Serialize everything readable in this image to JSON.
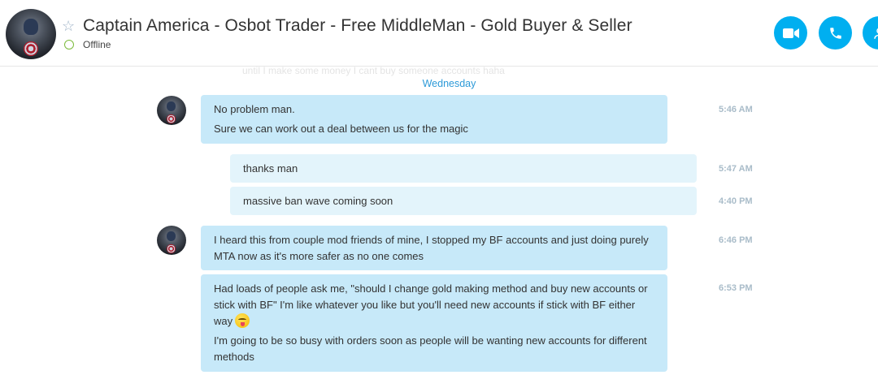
{
  "header": {
    "title": "Captain America - Osbot Trader - Free MiddleMan - Gold Buyer & Seller",
    "status": "Offline",
    "buttons": [
      "video-call",
      "voice-call",
      "add-people"
    ],
    "accent_color": "#00aff0",
    "status_color": "#7cbb3c"
  },
  "conversation": {
    "faded_previous_text": "until I make some money I cant buy someone accounts haha",
    "day_separator": "Wednesday",
    "messages": [
      {
        "direction": "incoming",
        "lines": [
          "No problem man.",
          "Sure we can work out a deal between us for the magic"
        ],
        "time": "5:46 AM"
      },
      {
        "direction": "outgoing",
        "lines": [
          "thanks man"
        ],
        "time": "5:47 AM"
      },
      {
        "direction": "outgoing",
        "lines": [
          "massive ban wave coming soon"
        ],
        "time": "4:40 PM"
      },
      {
        "direction": "incoming",
        "lines": [
          "I heard this from couple mod friends of mine, I stopped my BF accounts and just doing purely MTA now as it's more safer as no one comes"
        ],
        "time": "6:46 PM"
      },
      {
        "direction": "incoming",
        "lines": [
          "Had loads of people ask me, \"should I change gold making method and buy new accounts or stick with BF\" I'm like whatever you like but you'll need new accounts if stick with BF either way",
          "I'm going to be so busy with orders soon as people will be wanting new accounts for different methods"
        ],
        "emoji": "tongue-out-wink-emoji",
        "time": "6:53 PM"
      }
    ]
  },
  "colors": {
    "incoming_bubble": "#c7e9f9",
    "outgoing_bubble": "#e3f4fb",
    "timestamp": "#a9bcc9",
    "day_separator": "#2d9ad8"
  }
}
